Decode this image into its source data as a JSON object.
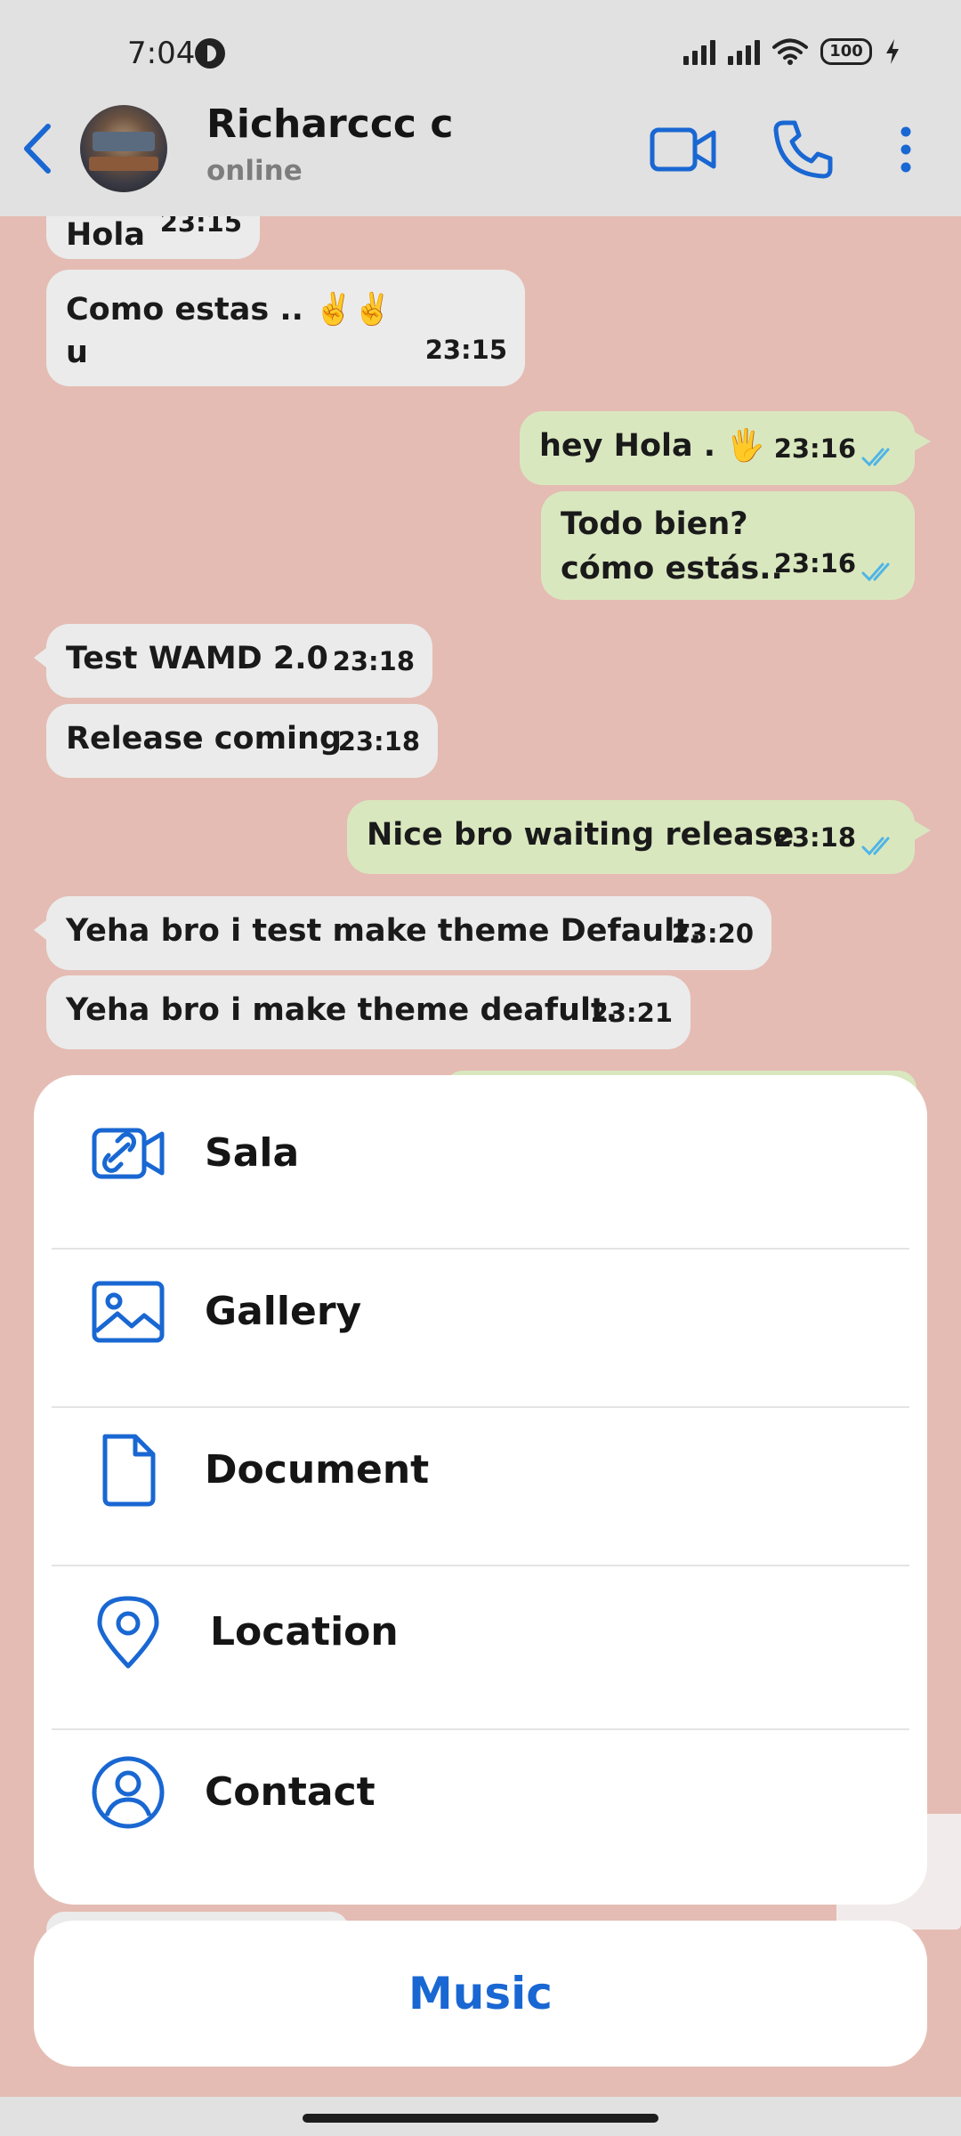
{
  "status_bar": {
    "time": "7:04",
    "battery": "100"
  },
  "header": {
    "name": "Richarccc c",
    "status": "online"
  },
  "messages": [
    {
      "dir": "in",
      "line1": "Hola",
      "line2": "",
      "time": "23:15"
    },
    {
      "dir": "in",
      "line1": "Como estas .. ✌️✌️",
      "line2": "u",
      "time": "23:15"
    },
    {
      "dir": "out",
      "line1": "hey Hola . 🖐️",
      "line2": "",
      "time": "23:16"
    },
    {
      "dir": "out",
      "line1": "Todo bien?",
      "line2": "cómo estás..",
      "time": "23:16"
    },
    {
      "dir": "in",
      "line1": "Test WAMD 2.0",
      "line2": "",
      "time": "23:18"
    },
    {
      "dir": "in",
      "line1": "Release coming",
      "line2": "",
      "time": "23:18"
    },
    {
      "dir": "out",
      "line1": "Nice bro waiting release",
      "line2": "",
      "time": "23:18"
    },
    {
      "dir": "in",
      "line1": "Yeha bro i test make theme Default.",
      "line2": "",
      "time": "23:20"
    },
    {
      "dir": "in",
      "line1": "Yeha bro i make theme deafult.",
      "line2": "",
      "time": "23:21"
    }
  ],
  "attach_menu": {
    "items": [
      {
        "label": "Sala",
        "icon": "video-link-icon"
      },
      {
        "label": "Gallery",
        "icon": "image-icon"
      },
      {
        "label": "Document",
        "icon": "document-icon"
      },
      {
        "label": "Location",
        "icon": "location-pin-icon"
      },
      {
        "label": "Contact",
        "icon": "contact-icon"
      }
    ],
    "music_label": "Music"
  },
  "colors": {
    "accent": "#1967d2",
    "chat_bg": "#e4bcb3",
    "bubble_in": "#ebebeb",
    "bubble_out": "#d9e7bf",
    "read_ticks": "#4fb5e6"
  }
}
